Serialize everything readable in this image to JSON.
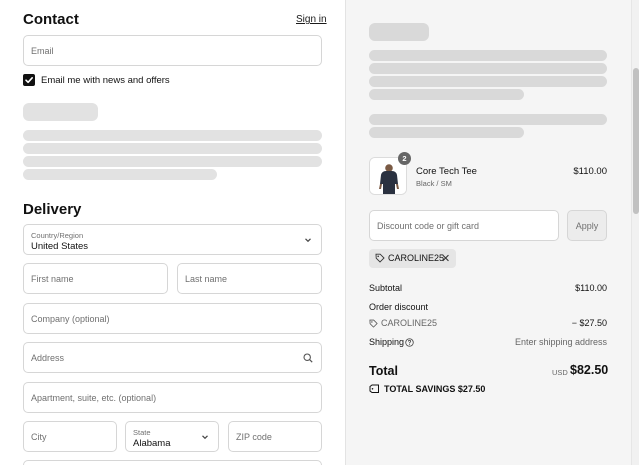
{
  "contact": {
    "title": "Contact",
    "signin_label": "Sign in",
    "email_placeholder": "Email",
    "newsletter_label": "Email me with news and offers",
    "newsletter_checked": true
  },
  "delivery": {
    "title": "Delivery",
    "country_label": "Country/Region",
    "country_value": "United States",
    "first_name_placeholder": "First name",
    "last_name_placeholder": "Last name",
    "company_placeholder": "Company (optional)",
    "address_placeholder": "Address",
    "apartment_placeholder": "Apartment, suite, etc. (optional)",
    "city_placeholder": "City",
    "state_label": "State",
    "state_value": "Alabama",
    "zip_placeholder": "ZIP code"
  },
  "summary": {
    "product": {
      "name": "Core Tech Tee",
      "variant": "Black / SM",
      "price": "$110.00",
      "quantity": "2"
    },
    "discount_placeholder": "Discount code or gift card",
    "apply_label": "Apply",
    "applied_code": "CAROLINE25",
    "subtotal_label": "Subtotal",
    "subtotal_value": "$110.00",
    "order_discount_label": "Order discount",
    "order_discount_code": "CAROLINE25",
    "order_discount_value": "− $27.50",
    "shipping_label": "Shipping",
    "shipping_value": "Enter shipping address",
    "total_label": "Total",
    "total_currency": "USD",
    "total_value": "$82.50",
    "savings_text": "TOTAL SAVINGS  $27.50"
  },
  "icons": {
    "search": "search-icon",
    "chevron": "chevron-down-icon",
    "tag": "tag-icon",
    "close": "close-icon",
    "help": "help-circle-icon",
    "check": "check-icon"
  }
}
